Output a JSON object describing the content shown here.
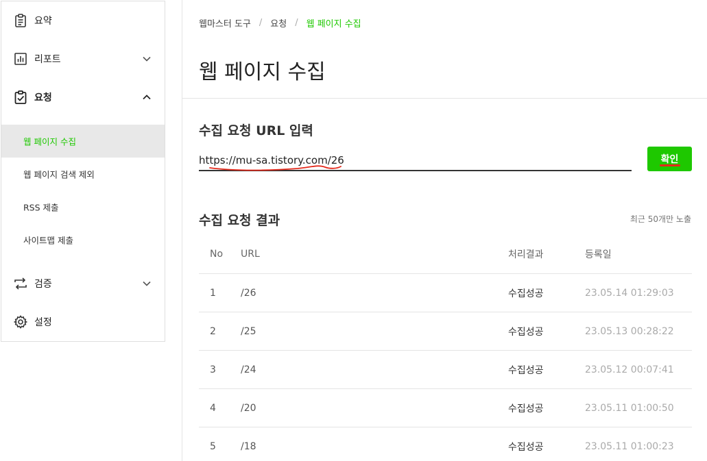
{
  "sidebar": {
    "items": [
      {
        "label": "요약",
        "icon": "clipboard-icon"
      },
      {
        "label": "리포트",
        "icon": "bar-chart-icon",
        "chevron": "chevron-down-icon"
      },
      {
        "label": "요청",
        "icon": "clipboard-check-icon",
        "chevron": "chevron-up-icon"
      },
      {
        "label": "검증",
        "icon": "repeat-arrows-icon",
        "chevron": "chevron-down-icon"
      },
      {
        "label": "설정",
        "icon": "gear-icon"
      }
    ],
    "subitems": [
      {
        "label": "웹 페이지 수집",
        "selected": true
      },
      {
        "label": "웹 페이지 검색 제외"
      },
      {
        "label": "RSS 제출"
      },
      {
        "label": "사이트맵 제출"
      }
    ]
  },
  "breadcrumb": [
    "웹마스터 도구",
    "요청",
    "웹 페이지 수집"
  ],
  "page_title": "웹 페이지 수집",
  "request": {
    "section_title": "수집 요청 URL 입력",
    "url_value": "https://mu-sa.tistory.com/26",
    "confirm_label": "확인"
  },
  "results": {
    "section_title": "수집 요청 결과",
    "note": "최근 50개만 노출",
    "columns": [
      "No",
      "URL",
      "처리결과",
      "등록일"
    ],
    "rows": [
      {
        "no": "1",
        "url": "/26",
        "result": "수집성공",
        "date": "23.05.14 01:29:03"
      },
      {
        "no": "2",
        "url": "/25",
        "result": "수집성공",
        "date": "23.05.13 00:28:22"
      },
      {
        "no": "3",
        "url": "/24",
        "result": "수집성공",
        "date": "23.05.12 00:07:41"
      },
      {
        "no": "4",
        "url": "/20",
        "result": "수집성공",
        "date": "23.05.11 01:00:50"
      },
      {
        "no": "5",
        "url": "/18",
        "result": "수집성공",
        "date": "23.05.11 01:00:23"
      }
    ]
  },
  "colors": {
    "accent": "#1ec800",
    "annotation_red": "#e4281a",
    "border": "#e4e4e4",
    "selected_bg": "#e8e8e8"
  }
}
